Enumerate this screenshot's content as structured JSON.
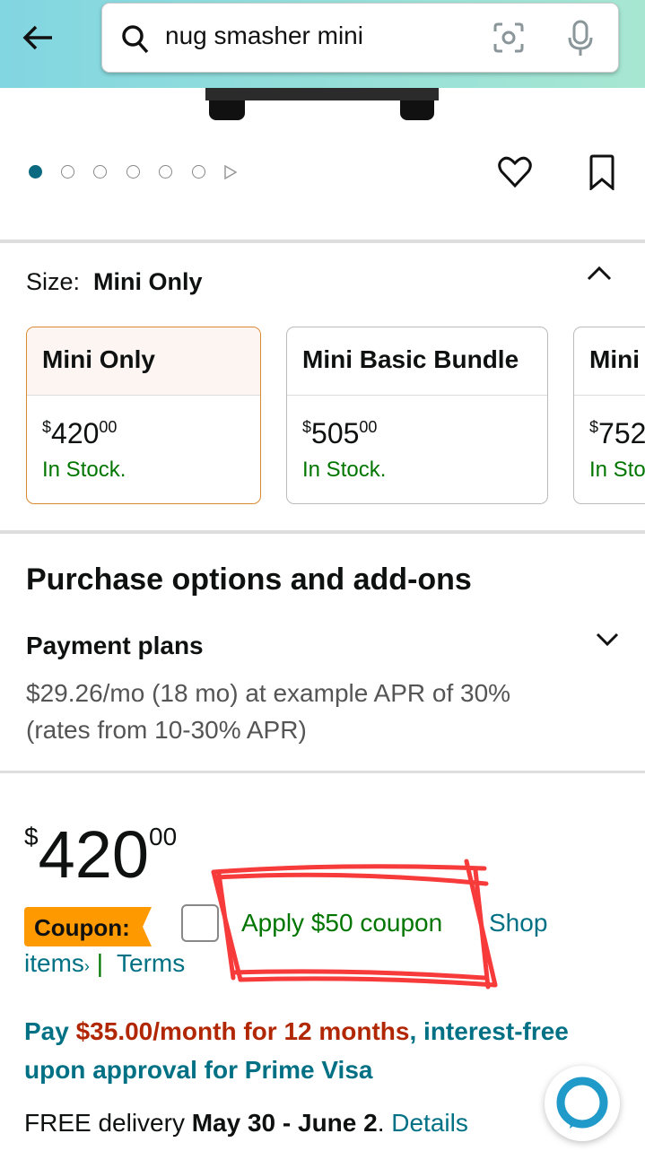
{
  "search": {
    "query": "nug smasher mini"
  },
  "gallery": {
    "image_count": 6,
    "active_index": 0
  },
  "size": {
    "label": "Size:",
    "selected": "Mini Only",
    "options": [
      {
        "name": "Mini Only",
        "price_whole": "420",
        "price_fraction": "00",
        "currency": "$",
        "stock": "In Stock.",
        "selected": true
      },
      {
        "name": "Mini Basic Bundle",
        "price_whole": "505",
        "price_fraction": "00",
        "currency": "$",
        "stock": "In Stock.",
        "selected": false
      },
      {
        "name": "Mini",
        "price_whole": "752",
        "price_fraction": "",
        "currency": "$",
        "stock": "In Stock.",
        "selected": false
      }
    ]
  },
  "purchase": {
    "heading": "Purchase options and add-ons",
    "payment_title": "Payment plans",
    "payment_text": "$29.26/mo (18 mo) at example APR of 30% (rates from 10-30% APR)"
  },
  "price": {
    "currency": "$",
    "whole": "420",
    "fraction": "00"
  },
  "coupon": {
    "badge": "Coupon:",
    "apply": "Apply $50 coupon",
    "shop": "Shop",
    "items": "items",
    "terms": "Terms",
    "separator": "|"
  },
  "financing": {
    "pre": "Pay ",
    "amount": "$35.00/month for 12 months",
    "post": ", interest-free upon approval for Prime Visa"
  },
  "delivery": {
    "pre": "FREE delivery ",
    "date": "May 30 - June 2",
    "dot": ". ",
    "details": "Details"
  },
  "colors": {
    "accent": "#007185",
    "stock_green": "#007600",
    "coupon_orange": "#ff9900",
    "price_red": "#b12704",
    "annotation": "#f73b3b"
  }
}
